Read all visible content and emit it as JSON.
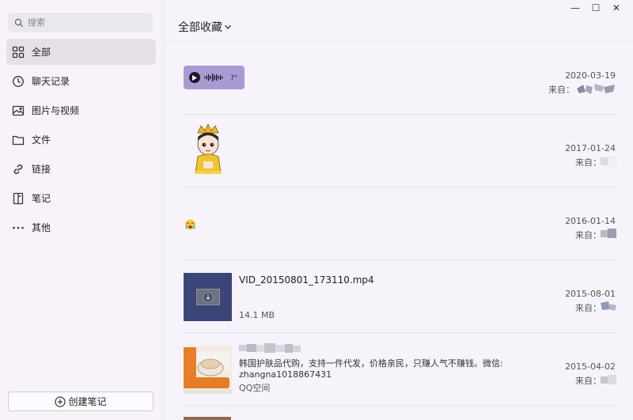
{
  "sidebar": {
    "search_placeholder": "搜索",
    "items": [
      {
        "label": "全部",
        "icon": "grid-icon",
        "active": true
      },
      {
        "label": "聊天记录",
        "icon": "clock-icon"
      },
      {
        "label": "图片与视频",
        "icon": "image-icon"
      },
      {
        "label": "文件",
        "icon": "folder-icon"
      },
      {
        "label": "链接",
        "icon": "link-icon"
      },
      {
        "label": "笔记",
        "icon": "note-icon"
      },
      {
        "label": "其他",
        "icon": "more-icon"
      }
    ],
    "create_label": "创建笔记"
  },
  "window": {
    "minimize": "—",
    "maximize": "☐",
    "close": "✕"
  },
  "main": {
    "title": "全部收藏",
    "from_label": "来自：",
    "items": [
      {
        "type": "voice",
        "duration": "7\"",
        "date": "2020-03-19"
      },
      {
        "type": "sticker",
        "date": "2017-01-24"
      },
      {
        "type": "emoji",
        "emoji": "😭",
        "date": "2016-01-14"
      },
      {
        "type": "file",
        "filename": "VID_20150801_173110.mp4",
        "size": "14.1 MB",
        "date": "2015-08-01"
      },
      {
        "type": "link",
        "line1": "韩国护肤品代购，支持一件代发，价格亲民，只赚人气不赚钱。微信:",
        "line2": "zhangna1018867431",
        "source": "QQ空间",
        "date": "2015-04-02"
      }
    ]
  },
  "colors": {
    "voice_bubble": "#a99bd2",
    "file_thumb": "#3b4577",
    "active_nav": "#e5e0e8"
  }
}
